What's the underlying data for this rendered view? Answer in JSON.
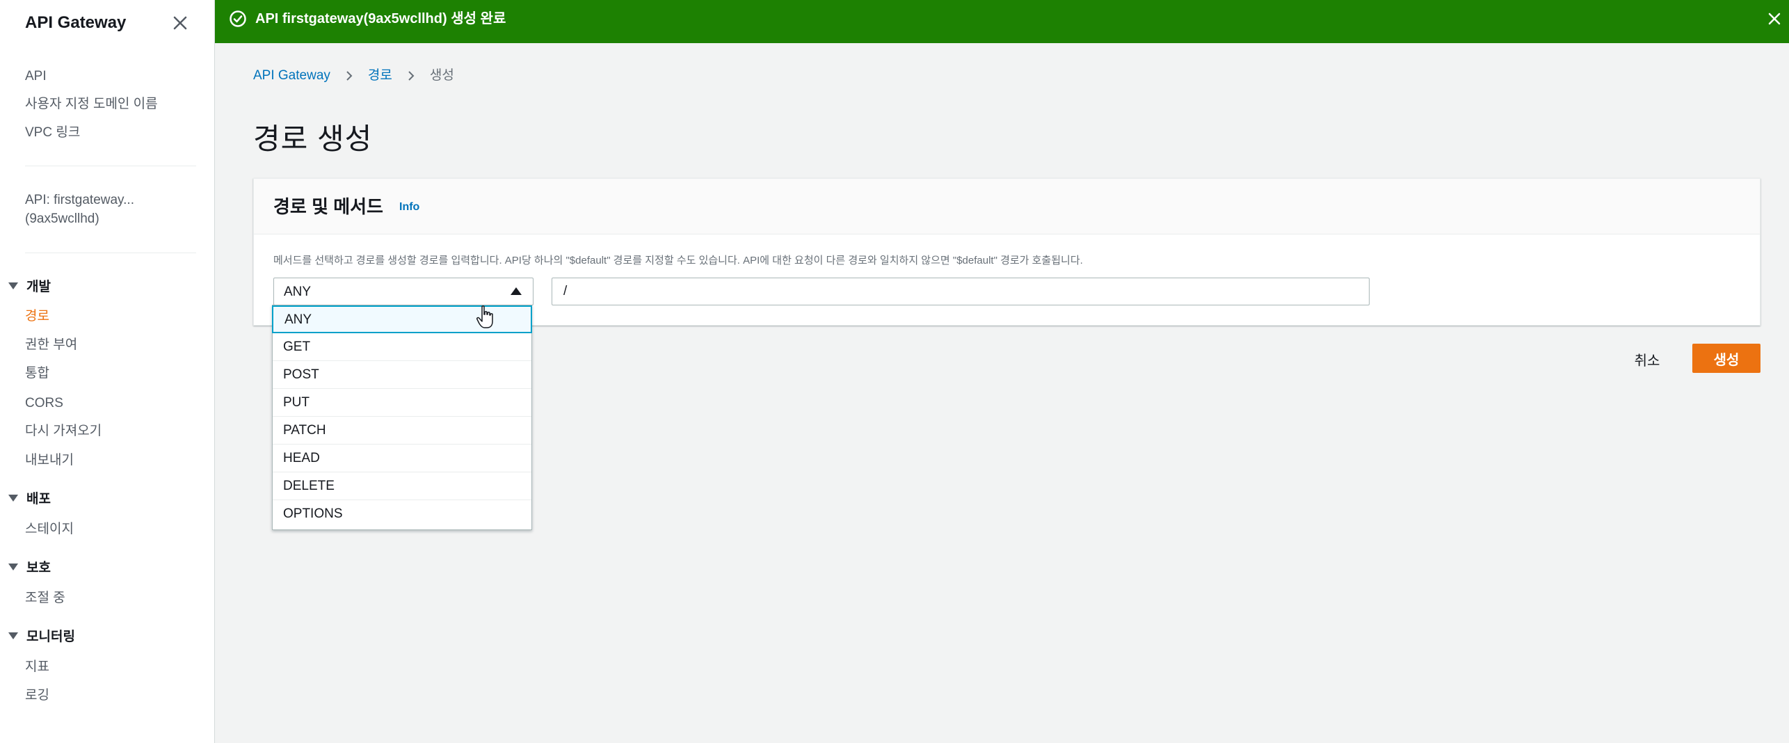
{
  "sidebar": {
    "title": "API Gateway",
    "top_links": [
      "API",
      "사용자 지정 도메인 이름",
      "VPC 링크"
    ],
    "api_label_line1": "API: firstgateway...",
    "api_label_line2": "(9ax5wcllhd)",
    "sections": [
      {
        "title": "개발",
        "items": [
          "경로",
          "권한 부여",
          "통합",
          "CORS",
          "다시 가져오기",
          "내보내기"
        ]
      },
      {
        "title": "배포",
        "items": [
          "스테이지"
        ]
      },
      {
        "title": "보호",
        "items": [
          "조절 중"
        ]
      },
      {
        "title": "모니터링",
        "items": [
          "지표",
          "로깅"
        ]
      }
    ],
    "active_item": "경로"
  },
  "flash": {
    "message": "API firstgateway(9ax5wcllhd) 생성 완료",
    "type": "success",
    "color": "#1d8102"
  },
  "breadcrumb": [
    "API Gateway",
    "경로",
    "생성"
  ],
  "page_title": "경로 생성",
  "panel": {
    "title": "경로 및 메서드",
    "info_link": "Info",
    "description": "메서드를 선택하고 경로를 생성할 경로를 입력합니다. API당 하나의 \"$default\" 경로를 지정할 수도 있습니다. API에 대한 요청이 다른 경로와 일치하지 않으면 \"$default\" 경로가 호출됩니다.",
    "method_value": "ANY",
    "path_value": "/"
  },
  "method_options": [
    "ANY",
    "GET",
    "POST",
    "PUT",
    "PATCH",
    "HEAD",
    "DELETE",
    "OPTIONS"
  ],
  "buttons": {
    "cancel": "취소",
    "create": "생성"
  },
  "colors": {
    "accent": "#ec7211",
    "link": "#0073bb",
    "success": "#1d8102"
  }
}
